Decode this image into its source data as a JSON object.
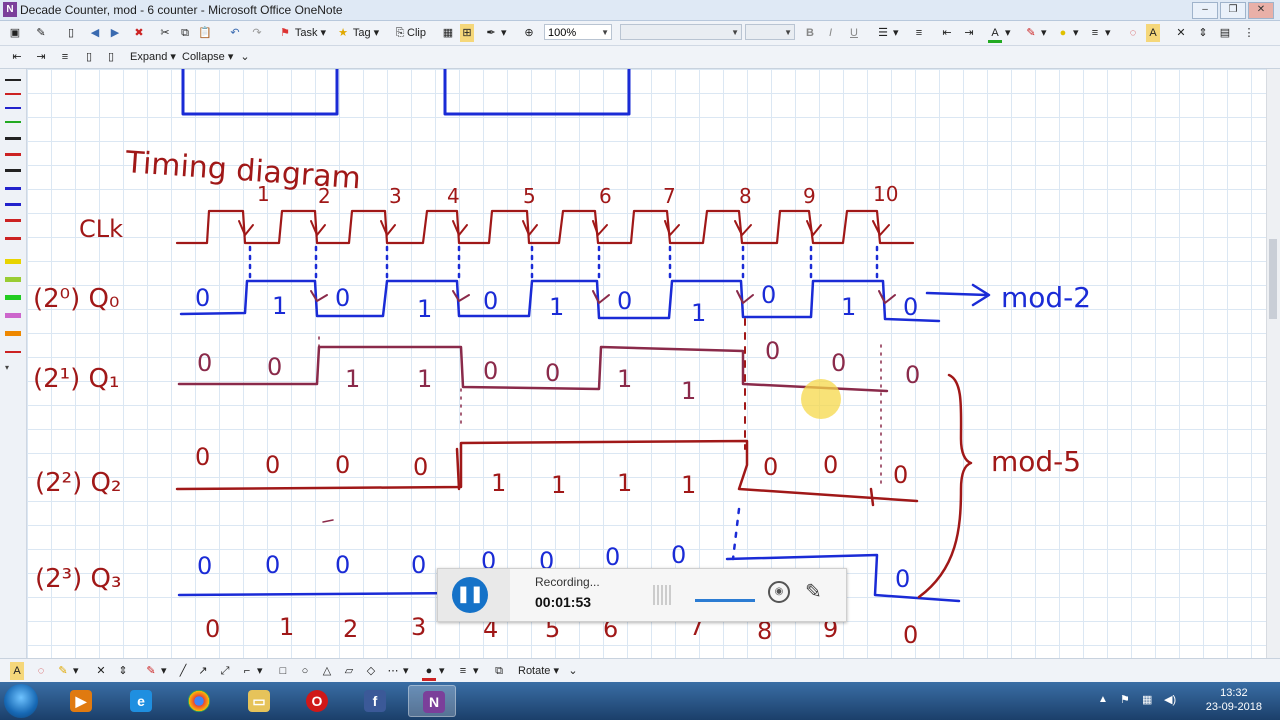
{
  "window": {
    "title": "Decade  Counter, mod - 6 counter  - Microsoft Office OneNote",
    "minimize": "–",
    "maximize": "❐",
    "close": "✕"
  },
  "toolbar": {
    "task_label": "Task",
    "tag_label": "Tag",
    "clip_label": "Clip",
    "zoom_value": "100%",
    "bold": "B",
    "italic": "I",
    "underline": "U"
  },
  "outline_bar": {
    "expand_label": "Expand",
    "collapse_label": "Collapse"
  },
  "drawing_bar": {
    "rotate_label": "Rotate"
  },
  "notes": {
    "heading": "Timing diagram",
    "clk_label": "CLk",
    "q0_label": "(2⁰) Q₀",
    "q1_label": "(2¹) Q₁",
    "q2_label": "(2²) Q₂",
    "q3_label": "(2³) Q₃",
    "mod2_label": "mod-2",
    "mod5_label": "mod-5",
    "pulse_numbers": [
      "1",
      "2",
      "3",
      "4",
      "5",
      "6",
      "7",
      "8",
      "9",
      "10"
    ],
    "q0_values": [
      "0",
      "1",
      "0",
      "1",
      "0",
      "1",
      "0",
      "1",
      "0",
      "1",
      "0"
    ],
    "q1_values": [
      "0",
      "0",
      "1",
      "1",
      "0",
      "0",
      "1",
      "1",
      "0",
      "0",
      "0"
    ],
    "q2_values": [
      "0",
      "0",
      "0",
      "0",
      "1",
      "1",
      "1",
      "1",
      "0",
      "0",
      "0"
    ],
    "q3_values": [
      "0",
      "0",
      "0",
      "0",
      "0",
      "0",
      "0",
      "0",
      "0"
    ],
    "count_values": [
      "0",
      "1",
      "2",
      "3",
      "4",
      "5",
      "6",
      "7",
      "8",
      "9",
      "0"
    ]
  },
  "recorder": {
    "status": "Recording...",
    "elapsed": "00:01:53"
  },
  "taskbar": {
    "time": "13:32",
    "date": "23-09-2018"
  },
  "colors": {
    "ink_red": "#a01818",
    "ink_blue": "#1a2bd6",
    "ink_maroon": "#8a2a4a",
    "grid": "#dbe7f3"
  }
}
